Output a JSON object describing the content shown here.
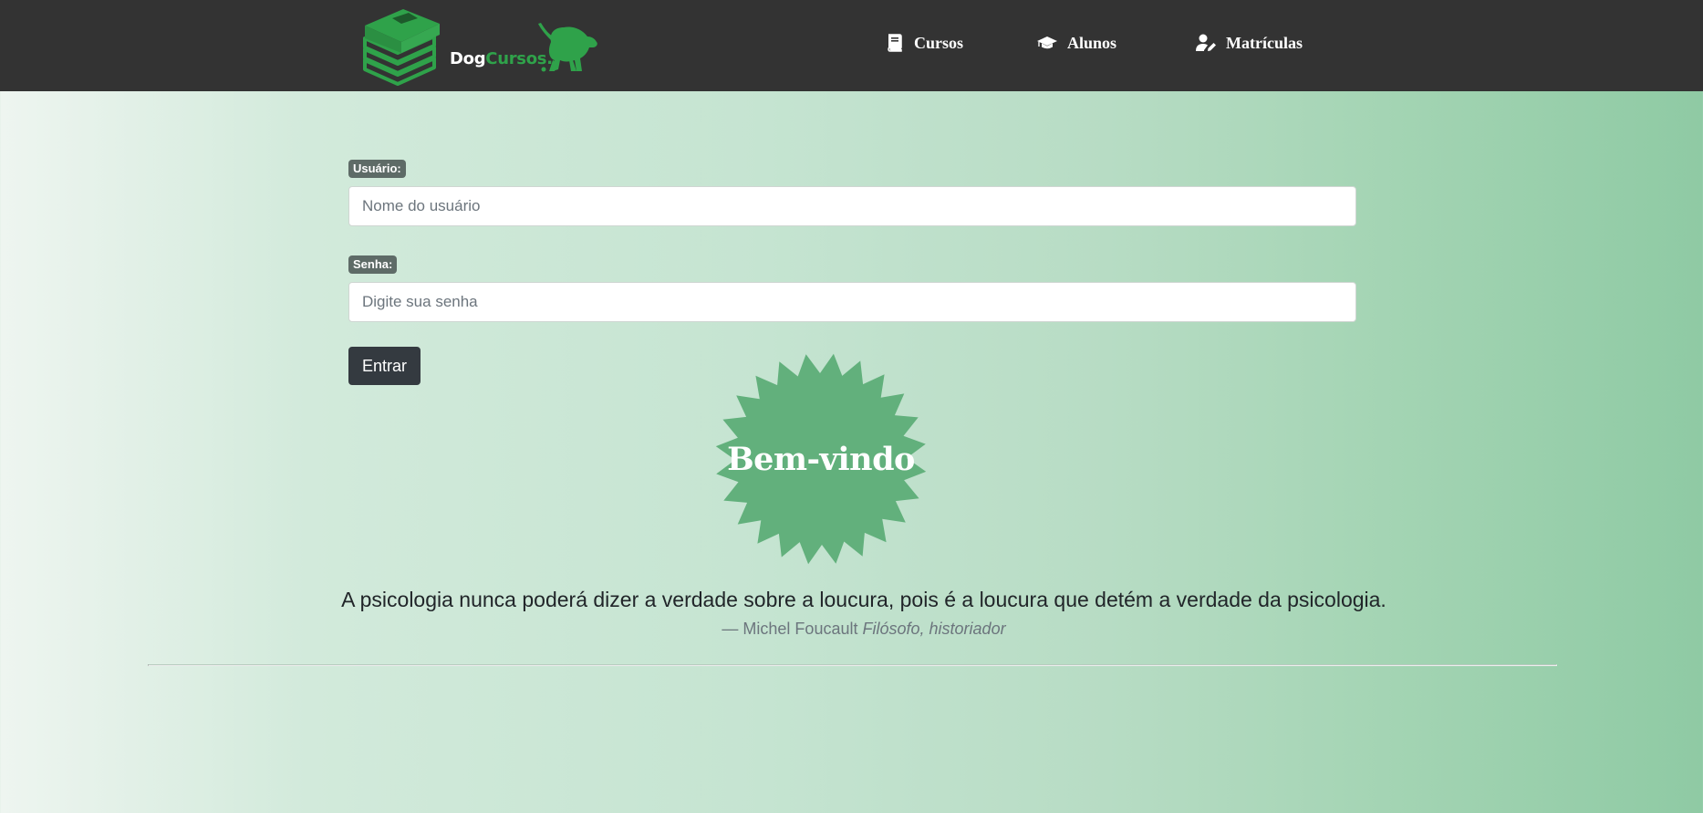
{
  "navbar": {
    "brand": {
      "dog": "Dog",
      "cursos": "Cursos",
      "dot": "."
    },
    "items": [
      {
        "label": "Cursos",
        "icon": "book-icon"
      },
      {
        "label": "Alunos",
        "icon": "graduation-cap-icon"
      },
      {
        "label": "Matrículas",
        "icon": "user-edit-icon"
      }
    ]
  },
  "login_form": {
    "username_label": "Usuário:",
    "username_placeholder": "Nome do usuário",
    "username_value": "",
    "password_label": "Senha:",
    "password_placeholder": "Digite sua senha",
    "password_value": "",
    "submit_label": "Entrar"
  },
  "welcome_badge": {
    "text": "Bem-vindo"
  },
  "quote": {
    "text": "A psicologia nunca poderá dizer a verdade sobre a loucura, pois é a loucura que detém a verdade da psicologia.",
    "dash": "—",
    "author": "Michel Foucault",
    "source": "Filósofo, historiador"
  },
  "colors": {
    "navbar_bg": "#333333",
    "brand_green": "#2fa24a",
    "badge_green": "#62b07c",
    "button_dark": "#343a40",
    "label_bg": "#5e6b67"
  }
}
